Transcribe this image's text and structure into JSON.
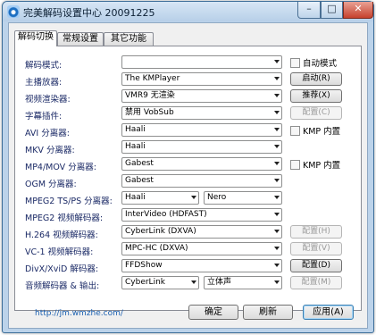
{
  "window": {
    "title": "完美解码设置中心 20091225",
    "minimize_glyph": "–",
    "maximize_glyph": "□",
    "close_glyph": "✕",
    "icon": "app-icon"
  },
  "tabs": [
    {
      "label": "解码切换",
      "active": true
    },
    {
      "label": "常规设置",
      "active": false
    },
    {
      "label": "其它功能",
      "active": false
    }
  ],
  "rows": [
    {
      "label": "解码模式:",
      "value": "",
      "button": "",
      "checkbox": "自动模式"
    },
    {
      "label": "主播放器:",
      "value": "The KMPlayer",
      "button": "启动(R)"
    },
    {
      "label": "视频渲染器:",
      "value": "VMR9 无渲染",
      "button": "推荐(X)"
    },
    {
      "label": "字幕插件:",
      "value": "禁用 VobSub",
      "button": "配置(C)",
      "button_disabled": true
    },
    {
      "label": "AVI 分离器:",
      "value": "Haali",
      "checkbox": "KMP 内置"
    },
    {
      "label": "MKV 分离器:",
      "value": "Haali"
    },
    {
      "label": "MP4/MOV 分离器:",
      "value": "Gabest",
      "checkbox": "KMP 内置"
    },
    {
      "label": "OGM 分离器:",
      "value": "Gabest"
    },
    {
      "label": "MPEG2 TS/PS 分离器:",
      "value": "Haali",
      "value2": "Nero"
    },
    {
      "label": "MPEG2 视频解码器:",
      "value": "InterVideo (HDFAST)"
    },
    {
      "label": "H.264 视频解码器:",
      "value": "CyberLink (DXVA)",
      "button": "配置(H)",
      "button_disabled": true
    },
    {
      "label": "VC-1 视频解码器:",
      "value": "MPC-HC (DXVA)",
      "button": "配置(V)",
      "button_disabled": true
    },
    {
      "label": "DivX/XviD 解码器:",
      "value": "FFDShow",
      "button": "配置(D)"
    },
    {
      "label": "音频解码器 & 输出:",
      "value": "CyberLink",
      "value2": "立体声",
      "button": "配置(M)",
      "button_disabled": true
    }
  ],
  "footer": {
    "link": "http://jm.wmzhe.com/",
    "ok_label": "确定",
    "refresh_label": "刷新",
    "apply_label": "应用(A)"
  }
}
